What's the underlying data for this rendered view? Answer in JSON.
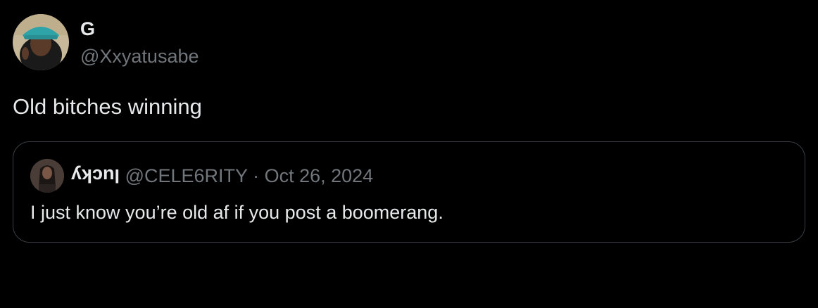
{
  "tweet": {
    "author_name": "G",
    "author_handle": "@Xxyatusabe",
    "text": "Old bitches winning"
  },
  "quote": {
    "author_name": "lucky",
    "author_handle": "@CELE6RITY",
    "separator": "·",
    "date": "Oct 26, 2024",
    "text": "I just know you’re old af if you post a boomerang."
  },
  "colors": {
    "background": "#000000",
    "primary_text": "#e7e9ea",
    "secondary_text": "#71767b",
    "border": "#3a3e42"
  }
}
